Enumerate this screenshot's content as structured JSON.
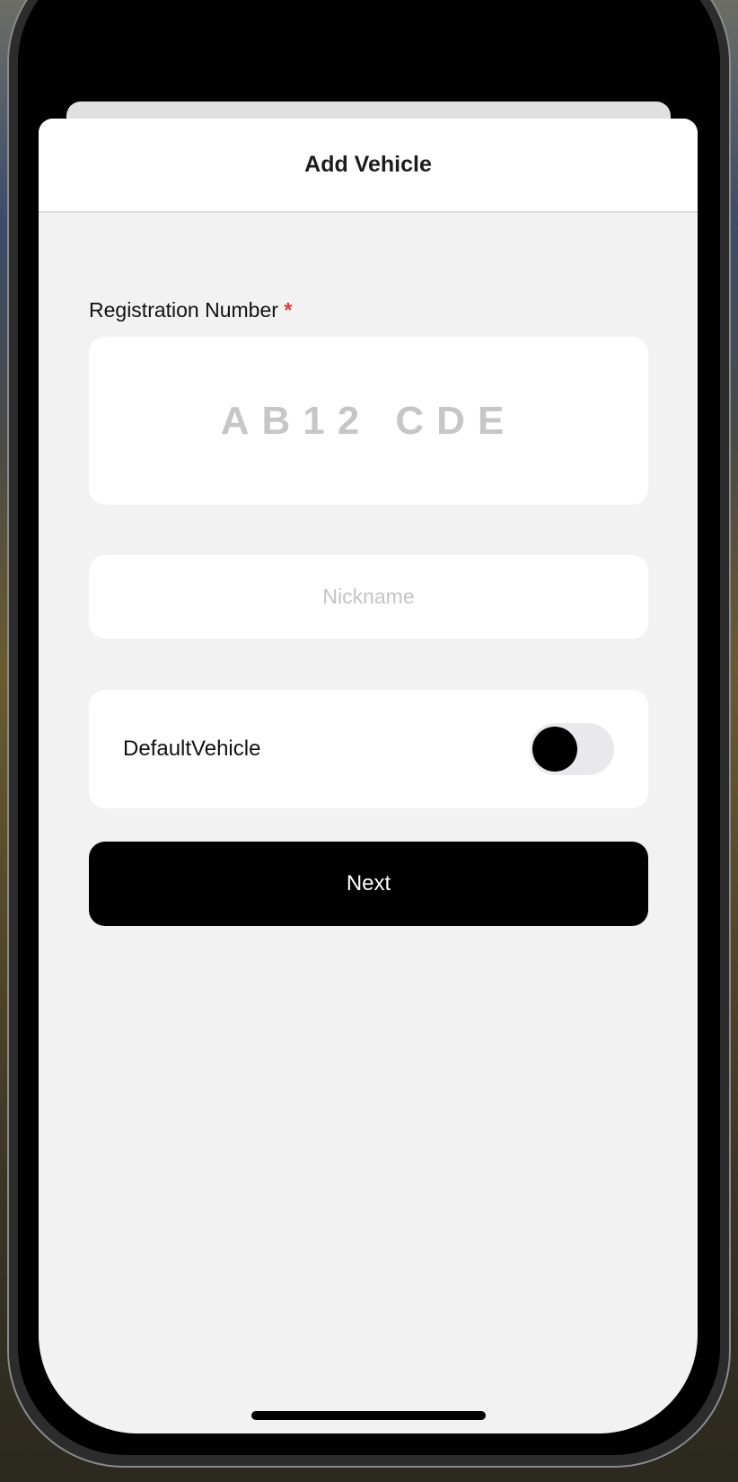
{
  "sheet": {
    "title": "Add Vehicle",
    "registration": {
      "label": "Registration Number",
      "required_marker": "*",
      "placeholder": "AB12 CDE",
      "value": ""
    },
    "nickname": {
      "placeholder": "Nickname",
      "value": ""
    },
    "default_vehicle": {
      "label": "DefaultVehicle",
      "on": false
    },
    "next_label": "Next"
  },
  "colors": {
    "accent": "#000000",
    "required": "#e53935",
    "background": "#f2f2f2"
  }
}
